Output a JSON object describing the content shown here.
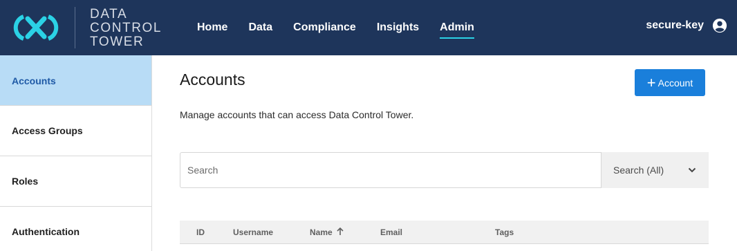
{
  "brand": {
    "line1": "DATA",
    "line2": "CONTROL",
    "line3": "TOWER",
    "accent": "#2bd2e6",
    "bar_color": "#1e355b"
  },
  "nav": {
    "items": [
      "Home",
      "Data",
      "Compliance",
      "Insights",
      "Admin"
    ],
    "active": "Admin"
  },
  "user": {
    "name": "secure-key",
    "icon": "account-circle-icon"
  },
  "sidebar": {
    "items": [
      {
        "label": "Accounts",
        "active": true
      },
      {
        "label": "Access Groups",
        "active": false
      },
      {
        "label": "Roles",
        "active": false
      },
      {
        "label": "Authentication",
        "active": false
      }
    ]
  },
  "main": {
    "title": "Accounts",
    "add_button_label": "Account",
    "add_button_icon": "plus-icon",
    "description": "Manage accounts that can access Data Control Tower.",
    "search": {
      "placeholder": "Search",
      "value": "",
      "scope": "Search (All)"
    },
    "table": {
      "columns": [
        "ID",
        "Username",
        "Name",
        "Email",
        "Tags"
      ],
      "sorted_column": "Name",
      "sort_direction": "ascending"
    }
  }
}
